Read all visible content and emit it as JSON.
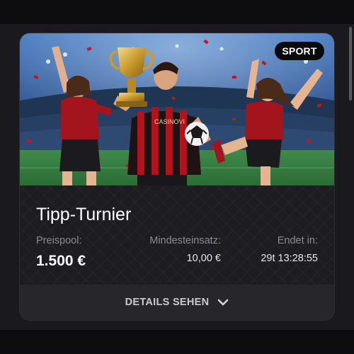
{
  "card": {
    "category_badge": "SPORT",
    "title": "Tipp-Turnier",
    "prize_pool": {
      "label": "Preispool:",
      "value": "1.500 €"
    },
    "min_stake": {
      "label": "Mindesteinsatz:",
      "value": "10,00 €"
    },
    "ends_in": {
      "label": "Endet in:",
      "value": "29t 13:28:55"
    },
    "details_button": {
      "label": "DETAILS SEHEN",
      "icon": "chevron-down-icon"
    }
  },
  "hero_image": {
    "jersey_text": "CASINOVI"
  },
  "colors": {
    "accent_red": "#b3121a",
    "card_background": "#1c1c21",
    "footer_background": "#26262b",
    "badge_background": "#0b0b0e"
  }
}
